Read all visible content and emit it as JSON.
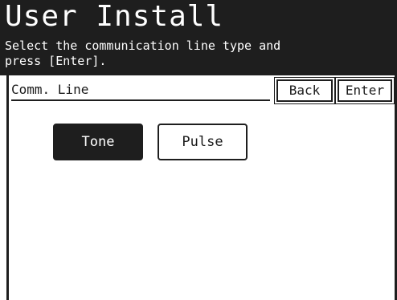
{
  "header": {
    "title": "User Install",
    "subtitle": "Select the communication line type and\npress [Enter]."
  },
  "section": {
    "label": "Comm. Line"
  },
  "buttons": {
    "back": "Back",
    "enter": "Enter"
  },
  "options": [
    {
      "label": "Tone",
      "selected": true
    },
    {
      "label": "Pulse",
      "selected": false
    }
  ],
  "colors": {
    "dark": "#1e1e1e",
    "light": "#ffffff"
  }
}
